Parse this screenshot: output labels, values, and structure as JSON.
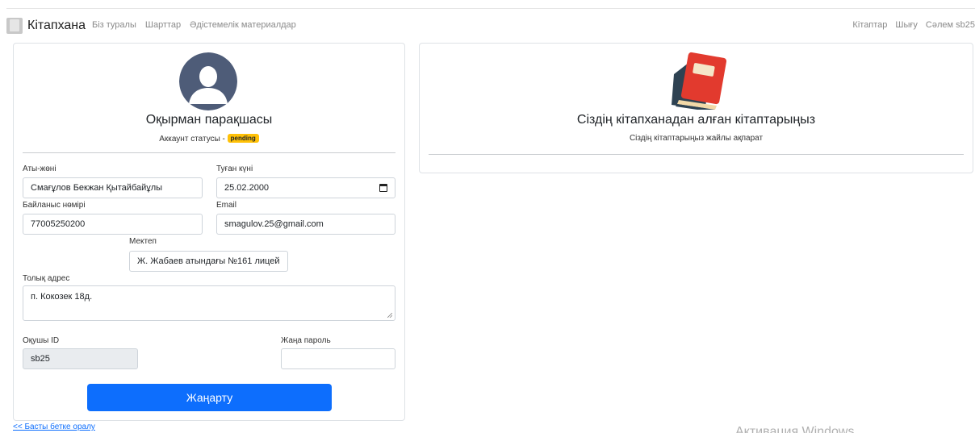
{
  "navbar": {
    "brand": "Кітапхана",
    "left_links": [
      "Біз туралы",
      "Шарттар",
      "Әдістемелік материалдар"
    ],
    "right_links": [
      "Кітаптар",
      "Шығу",
      "Сәлем sb25"
    ]
  },
  "profile": {
    "title": "Оқырман парақшасы",
    "status_label": "Аккаунт статусы -",
    "status_badge": "pending",
    "fields": {
      "full_name": {
        "label": "Аты-жөні",
        "value": "Смағұлов Бекжан Қытайбайұлы"
      },
      "birth_date": {
        "label": "Туған күні",
        "value": "25.02.2000"
      },
      "phone": {
        "label": "Байланыс нөмірі",
        "value": "77005250200"
      },
      "email": {
        "label": "Email",
        "value": "smagulov.25@gmail.com"
      },
      "school": {
        "label": "Мектеп",
        "value": "Ж. Жабаев атындағы №161 лицей"
      },
      "address": {
        "label": "Толық адрес",
        "value": "п. Кокозек 18д."
      },
      "student_id": {
        "label": "Оқушы ID",
        "value": "sb25"
      },
      "new_password": {
        "label": "Жаңа пароль",
        "value": ""
      }
    },
    "update_button": "Жаңарту"
  },
  "history": {
    "title": "Сіздің кітапханадан алған кітаптарыңыз",
    "subtitle": "Сіздің кітаптарыңыз жайлы ақпарат"
  },
  "back_link": "<< Басты бетке оралу",
  "watermark": "Активация Windows",
  "colors": {
    "primary": "#0d6efd",
    "badge": "#ffc107",
    "avatar": "#4e5c78",
    "book_red": "#e23a2e",
    "book_dark": "#2e4252"
  },
  "icons": {
    "avatar": "user-silhouette-icon",
    "books": "books-stack-icon",
    "calendar": "calendar-icon"
  }
}
